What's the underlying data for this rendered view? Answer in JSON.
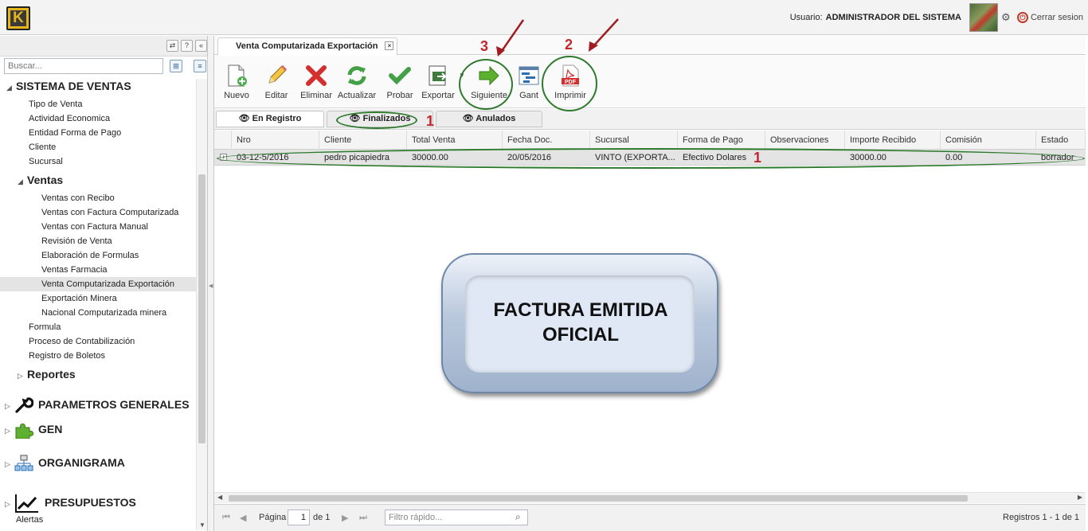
{
  "header": {
    "logo_letter": "K",
    "user_label": "Usuario:",
    "user_name": "ADMINISTRADOR DEL SISTEMA",
    "logout_label": "Cerrar sesion"
  },
  "sidebar": {
    "search_placeholder": "Buscar...",
    "section_ventas": "SISTEMA DE VENTAS",
    "items_top": [
      "Tipo de Venta",
      "Actividad Economica",
      "Entidad Forma de Pago",
      "Cliente",
      "Sucursal"
    ],
    "sub_ventas": "Ventas",
    "ventas_items": [
      "Ventas con Recibo",
      "Ventas con Factura Computarizada",
      "Ventas con Factura Manual",
      "Revisión de Venta",
      "Elaboración de Formulas",
      "Ventas Farmacia",
      "Venta Computarizada Exportación",
      "Exportación Minera",
      "Nacional Computarizada minera"
    ],
    "items_after": [
      "Formula",
      "Proceso de Contabilización",
      "Registro de Boletos"
    ],
    "sub_reportes": "Reportes",
    "modules": [
      "PARAMETROS GENERALES",
      "GEN",
      "ORGANIGRAMA",
      "PRESUPUESTOS"
    ],
    "last_item": "Alertas"
  },
  "main": {
    "tab_title": "Venta Computarizada Exportación",
    "toolbar": [
      "Nuevo",
      "Editar",
      "Eliminar",
      "Actualizar",
      "Probar",
      "Exportar",
      "Siguiente",
      "Gant",
      "Imprimir"
    ],
    "subtabs": [
      "En Registro",
      "Finalizados",
      "Anulados"
    ],
    "columns": [
      "Nro",
      "Cliente",
      "Total Venta",
      "Fecha Doc.",
      "Sucursal",
      "Forma de Pago",
      "Observaciones",
      "Importe Recibido",
      "Comisión",
      "Estado"
    ],
    "row": [
      "03-12-5/2016",
      "pedro picapiedra",
      "30000.00",
      "20/05/2016",
      "VINTO (EXPORTA...",
      "Efectivo Dolares",
      "",
      "30000.00",
      "0.00",
      "borrador"
    ]
  },
  "pager": {
    "page_label": "Página",
    "page_value": "1",
    "of_label": "de 1",
    "filter_placeholder": "Filtro rápido...",
    "records": "Registros 1 - 1 de 1"
  },
  "annotations": {
    "num1": "1",
    "num2": "2",
    "num3": "3",
    "num1_row": "1",
    "callout": "FACTURA EMITIDA OFICIAL"
  },
  "colors": {
    "annotation_ring": "#2d7a2d",
    "annotation_number": "#c0282e",
    "selected_row": "#e4e4e4"
  }
}
